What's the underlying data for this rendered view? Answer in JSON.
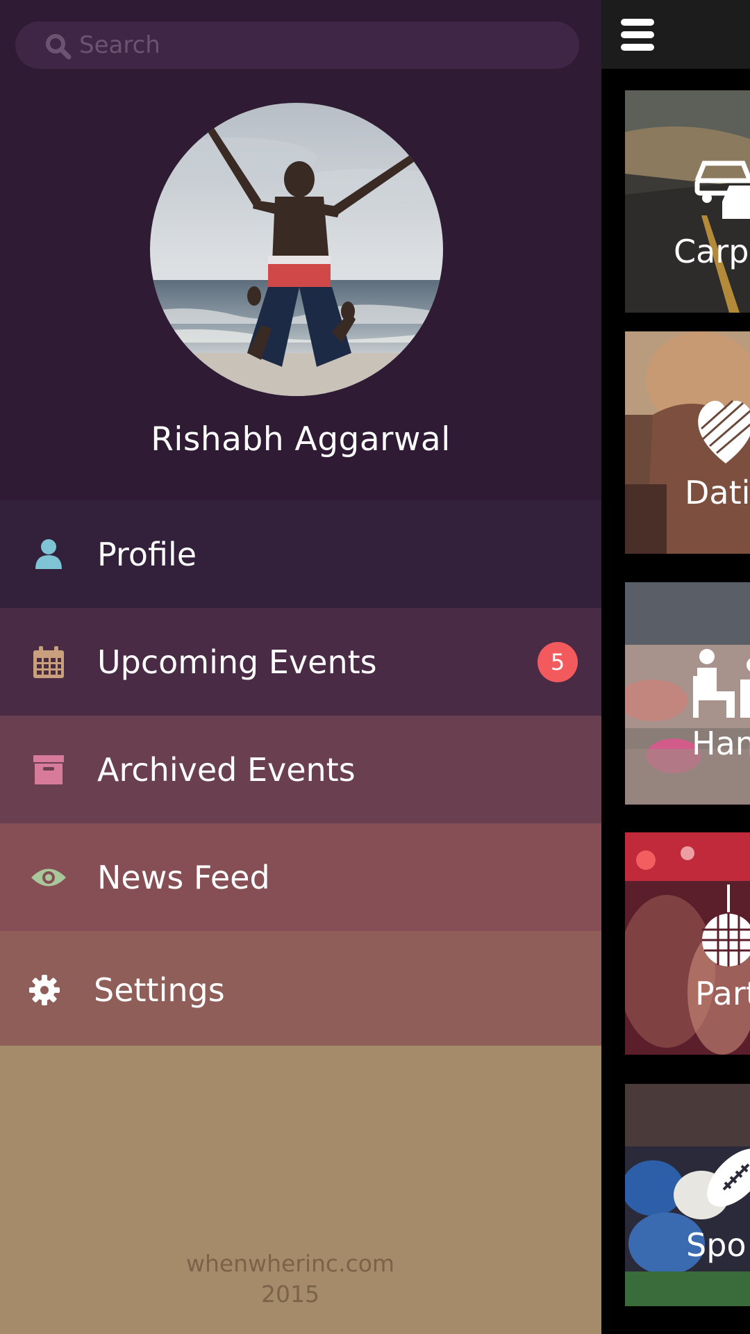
{
  "search": {
    "placeholder": "Search",
    "value": ""
  },
  "user": {
    "name": "Rishabh Aggarwal"
  },
  "menu": {
    "items": [
      {
        "label": "Profile",
        "icon": "user-icon",
        "icon_color": "#7ec4d4"
      },
      {
        "label": "Upcoming Events",
        "icon": "calendar-icon",
        "icon_color": "#c9a07e",
        "badge": "5"
      },
      {
        "label": "Archived Events",
        "icon": "archive-box-icon",
        "icon_color": "#d87a9a"
      },
      {
        "label": "News Feed",
        "icon": "eye-icon",
        "icon_color": "#a9c79a"
      },
      {
        "label": "Settings",
        "icon": "gear-icon",
        "icon_color": "#ffffff"
      }
    ]
  },
  "footer": {
    "site": "whenwherinc.com",
    "year": "2015"
  },
  "categories": [
    {
      "label": "Carpo",
      "icon": "cars-icon"
    },
    {
      "label": "Datir",
      "icon": "heart-icon"
    },
    {
      "label": "Hang",
      "icon": "people-sitting-icon"
    },
    {
      "label": "Part",
      "icon": "disco-ball-icon"
    },
    {
      "label": "Spo",
      "icon": "football-icon"
    }
  ],
  "colors": {
    "drawer_bg": "#2f1b33",
    "badge": "#f25a5e",
    "footer_bg": "#a68b6a"
  }
}
